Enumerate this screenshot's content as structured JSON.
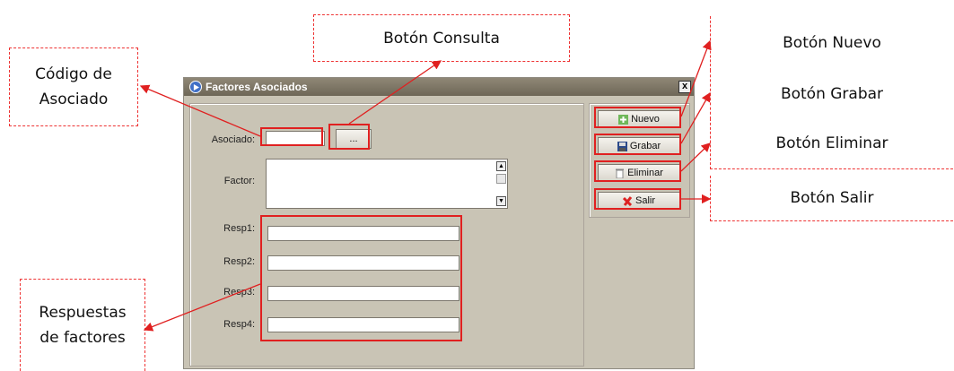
{
  "callouts": {
    "codigo_asociado": "Código de Asociado",
    "boton_consulta": "Botón Consulta",
    "boton_nuevo": "Botón Nuevo",
    "boton_grabar": "Botón Grabar",
    "boton_eliminar": "Botón Eliminar",
    "boton_salir": "Botón Salir",
    "respuestas": "Respuestas de factores"
  },
  "window": {
    "title": "Factores Asociados",
    "close_label": "x"
  },
  "form": {
    "asociado_label": "Asociado:",
    "asociado_value": "",
    "consulta_label": "...",
    "factor_label": "Factor:",
    "factor_value": "",
    "resp1_label": "Resp1:",
    "resp2_label": "Resp2:",
    "resp3_label": "Resp3:",
    "resp4_label": "Resp4:",
    "resp1_value": "",
    "resp2_value": "",
    "resp3_value": "",
    "resp4_value": ""
  },
  "toolbar": {
    "nuevo": "Nuevo",
    "grabar": "Grabar",
    "eliminar": "Eliminar",
    "salir": "Salir"
  },
  "colors": {
    "highlight": "#e02020",
    "window_bg": "#c9c4b5",
    "titlebar": "#6e6757"
  }
}
